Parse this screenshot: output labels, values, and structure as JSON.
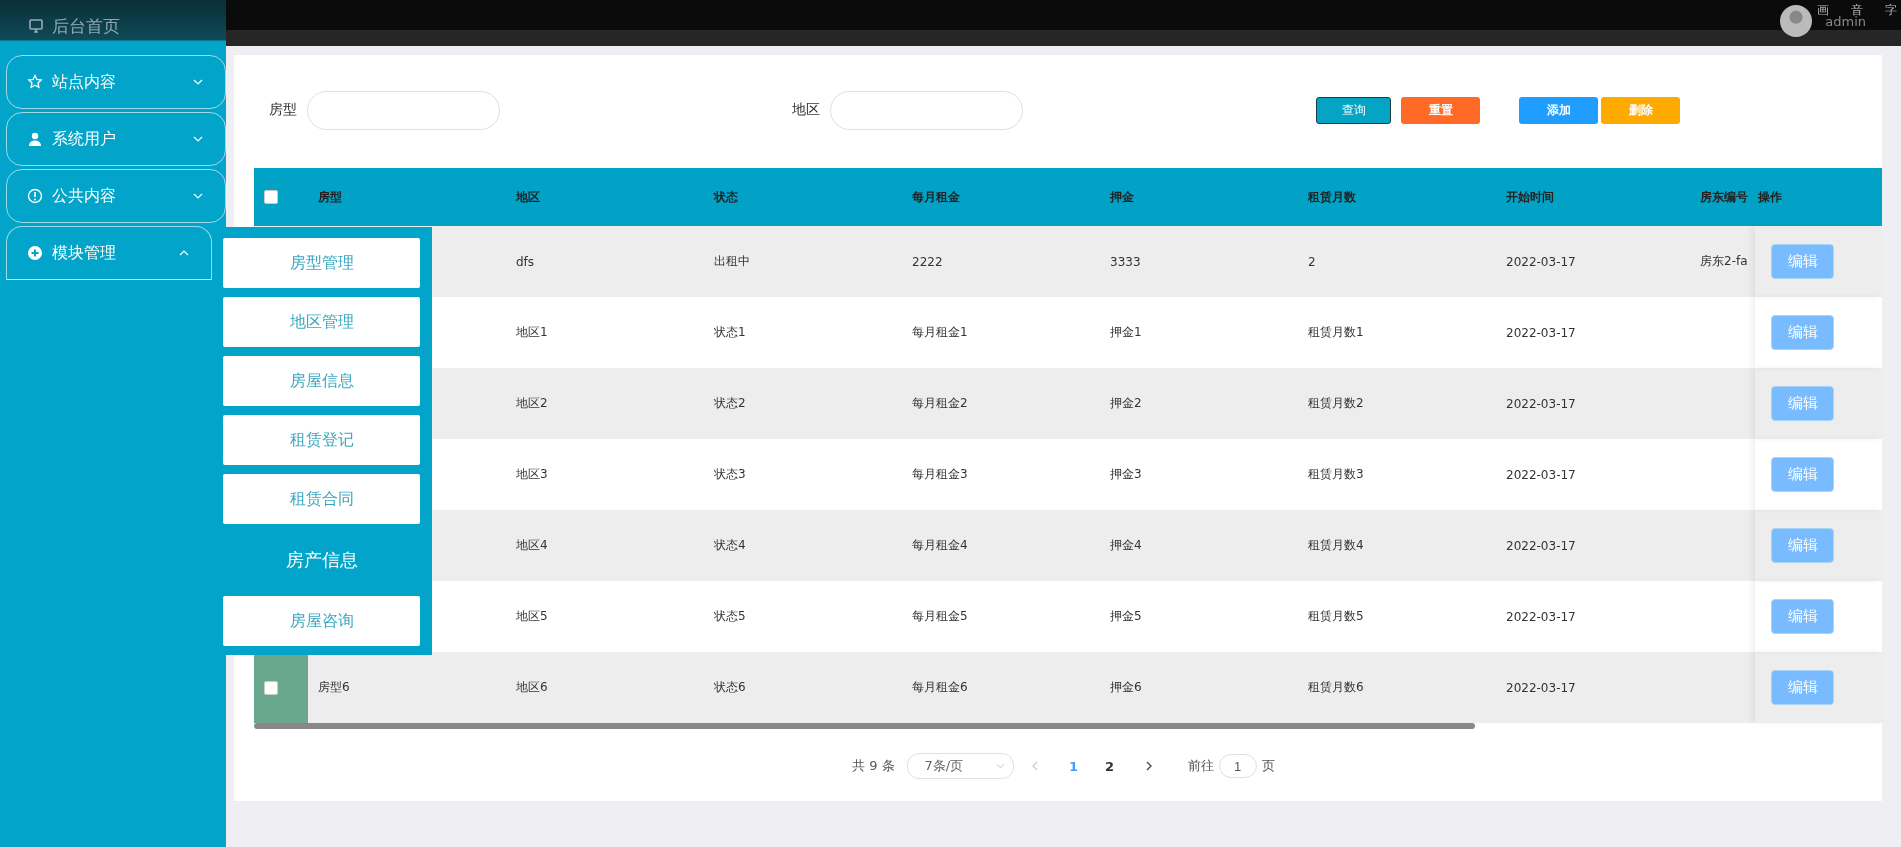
{
  "sidebar": {
    "home": "后台首页",
    "items": [
      {
        "label": "站点内容",
        "expanded": false
      },
      {
        "label": "系统用户",
        "expanded": false
      },
      {
        "label": "公共内容",
        "expanded": false
      },
      {
        "label": "模块管理",
        "expanded": true
      }
    ]
  },
  "submenu": [
    {
      "kind": "item",
      "label": "房型管理"
    },
    {
      "kind": "item",
      "label": "地区管理"
    },
    {
      "kind": "item",
      "label": "房屋信息"
    },
    {
      "kind": "item",
      "label": "租赁登记"
    },
    {
      "kind": "item",
      "label": "租赁合同"
    },
    {
      "kind": "heading",
      "label": "房产信息"
    },
    {
      "kind": "item",
      "label": "房屋咨询"
    }
  ],
  "topbar": {
    "tools": [
      "画",
      "音",
      "字"
    ],
    "user": "admin"
  },
  "filters": [
    {
      "label": "房型"
    },
    {
      "label": "地区"
    }
  ],
  "buttons": [
    {
      "label": "查询",
      "kind": "search"
    },
    {
      "label": "重置",
      "kind": "reset"
    },
    {
      "label": "添加",
      "kind": "add"
    },
    {
      "label": "删除",
      "kind": "delete"
    }
  ],
  "table": {
    "columns": [
      "房型",
      "地区",
      "状态",
      "每月租金",
      "押金",
      "租赁月数",
      "开始时间",
      "房东编号",
      "操作"
    ],
    "header_checked": false,
    "rows": [
      {
        "cells": [
          null,
          "dfs",
          "出租中",
          "2222",
          "3333",
          "2",
          "2022-03-17",
          "房东2-fa"
        ],
        "action": "编辑"
      },
      {
        "cells": [
          null,
          "地区1",
          "状态1",
          "每月租金1",
          "押金1",
          "租赁月数1",
          "2022-03-17",
          null
        ],
        "action": "编辑"
      },
      {
        "cells": [
          null,
          "地区2",
          "状态2",
          "每月租金2",
          "押金2",
          "租赁月数2",
          "2022-03-17",
          null
        ],
        "action": "编辑"
      },
      {
        "cells": [
          null,
          "地区3",
          "状态3",
          "每月租金3",
          "押金3",
          "租赁月数3",
          "2022-03-17",
          null
        ],
        "action": "编辑"
      },
      {
        "cells": [
          null,
          "地区4",
          "状态4",
          "每月租金4",
          "押金4",
          "租赁月数4",
          "2022-03-17",
          null
        ],
        "action": "编辑"
      },
      {
        "cells": [
          null,
          "地区5",
          "状态5",
          "每月租金5",
          "押金5",
          "租赁月数5",
          "2022-03-17",
          null
        ],
        "action": "编辑"
      },
      {
        "cells": [
          "房型6",
          "地区6",
          "状态6",
          "每月租金6",
          "押金6",
          "租赁月数6",
          "2022-03-17",
          null
        ],
        "action": "编辑",
        "checked": false,
        "highlighted": true
      }
    ]
  },
  "pagination": {
    "total": "共 9 条",
    "page_size": "7条/页",
    "pages": [
      {
        "label": "1",
        "selected": true
      },
      {
        "label": "2",
        "selected": false
      }
    ],
    "goto_label": "前往",
    "goto_value": "1",
    "goto_suffix": "页"
  }
}
